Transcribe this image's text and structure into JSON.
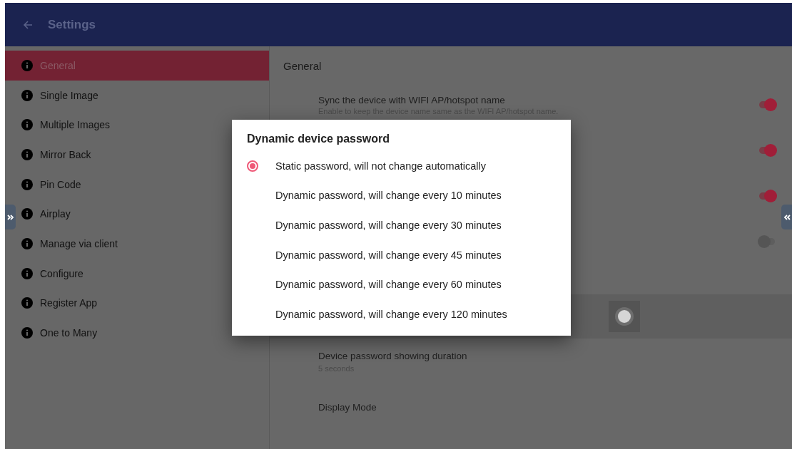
{
  "app_bar": {
    "title": "Settings"
  },
  "sidebar": {
    "items": [
      {
        "label": "General",
        "selected": true
      },
      {
        "label": "Single Image",
        "selected": false
      },
      {
        "label": "Multiple Images",
        "selected": false
      },
      {
        "label": "Mirror Back",
        "selected": false
      },
      {
        "label": "Pin Code",
        "selected": false
      },
      {
        "label": "Airplay",
        "selected": false
      },
      {
        "label": "Manage via client",
        "selected": false
      },
      {
        "label": "Configure",
        "selected": false
      },
      {
        "label": "Register App",
        "selected": false
      },
      {
        "label": "One to Many",
        "selected": false
      }
    ]
  },
  "content": {
    "heading": "General",
    "settings": [
      {
        "kind": "toggle",
        "title": "Sync the device with WIFI AP/hotspot name",
        "subtitle": "Enable to keep the device name same as the WIFI AP/hotspot name.",
        "on": true
      },
      {
        "kind": "toggle",
        "on": true
      },
      {
        "kind": "toggle",
        "on": true
      },
      {
        "kind": "toggle",
        "on": false
      },
      {
        "kind": "focused_toggle",
        "on": false
      },
      {
        "kind": "text",
        "title": "Device password showing duration",
        "subtitle": "5 seconds"
      },
      {
        "kind": "text",
        "title": "Display Mode"
      }
    ]
  },
  "dialog": {
    "title": "Dynamic device password",
    "options": [
      {
        "label": "Static password, will not change automatically",
        "selected": true
      },
      {
        "label": "Dynamic password, will change every 10 minutes",
        "selected": false
      },
      {
        "label": "Dynamic password, will change every 30 minutes",
        "selected": false
      },
      {
        "label": "Dynamic password, will change every 45 minutes",
        "selected": false
      },
      {
        "label": "Dynamic password, will change every 60 minutes",
        "selected": false
      },
      {
        "label": "Dynamic password, will change every 120 minutes",
        "selected": false
      }
    ]
  }
}
